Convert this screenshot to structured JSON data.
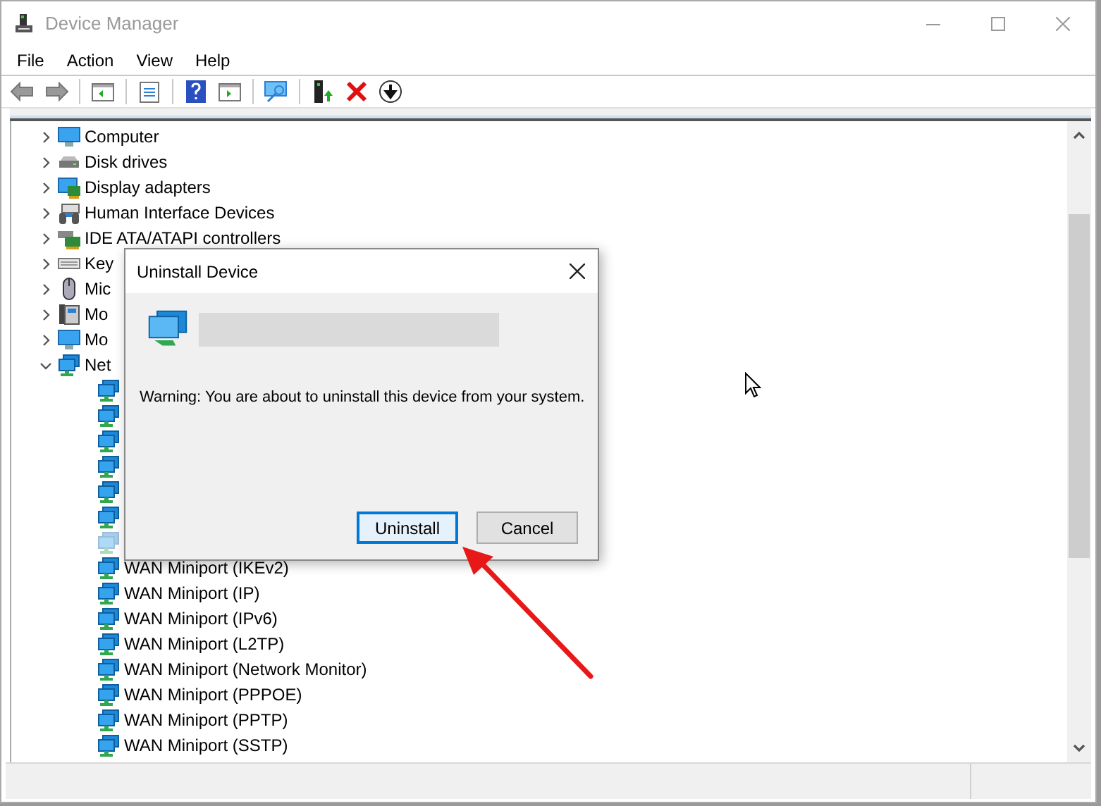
{
  "window": {
    "title": "Device Manager"
  },
  "menu": [
    "File",
    "Action",
    "View",
    "Help"
  ],
  "tree": [
    {
      "label": "Computer",
      "kind": "monitor",
      "expanded": false
    },
    {
      "label": "Disk drives",
      "kind": "disk",
      "expanded": false
    },
    {
      "label": "Display adapters",
      "kind": "display",
      "expanded": false
    },
    {
      "label": "Human Interface Devices",
      "kind": "hid",
      "expanded": false
    },
    {
      "label": "IDE ATA/ATAPI controllers",
      "kind": "ide",
      "expanded": false
    },
    {
      "label": "Key",
      "kind": "keyboard",
      "expanded": false
    },
    {
      "label": "Mic",
      "kind": "mouse",
      "expanded": false
    },
    {
      "label": "Mo",
      "kind": "modem",
      "expanded": false
    },
    {
      "label": "Mo",
      "kind": "monitor",
      "expanded": false
    },
    {
      "label": "Net",
      "kind": "network",
      "expanded": true,
      "children": [
        {
          "kind": "covered",
          "disabled": false
        },
        {
          "kind": "covered",
          "disabled": false
        },
        {
          "kind": "covered",
          "disabled": false
        },
        {
          "kind": "covered",
          "disabled": false
        },
        {
          "kind": "covered",
          "disabled": false
        },
        {
          "kind": "covered",
          "disabled": false
        },
        {
          "kind": "covered",
          "disabled": true
        },
        {
          "kind": "network",
          "label": "WAN Miniport (IKEv2)",
          "disabled": false
        },
        {
          "kind": "network",
          "label": "WAN Miniport (IP)",
          "disabled": false
        },
        {
          "kind": "network",
          "label": "WAN Miniport (IPv6)",
          "disabled": false
        },
        {
          "kind": "network",
          "label": "WAN Miniport (L2TP)",
          "disabled": false
        },
        {
          "kind": "network",
          "label": "WAN Miniport (Network Monitor)",
          "disabled": false
        },
        {
          "kind": "network",
          "label": "WAN Miniport (PPPOE)",
          "disabled": false
        },
        {
          "kind": "network",
          "label": "WAN Miniport (PPTP)",
          "disabled": false
        },
        {
          "kind": "network",
          "label": "WAN Miniport (SSTP)",
          "disabled": false
        }
      ]
    }
  ],
  "dialog": {
    "title": "Uninstall Device",
    "warning": "Warning: You are about to uninstall this device from your system.",
    "buttons": [
      {
        "label": "Uninstall",
        "selected": true
      },
      {
        "label": "Cancel",
        "selected": false
      }
    ]
  }
}
